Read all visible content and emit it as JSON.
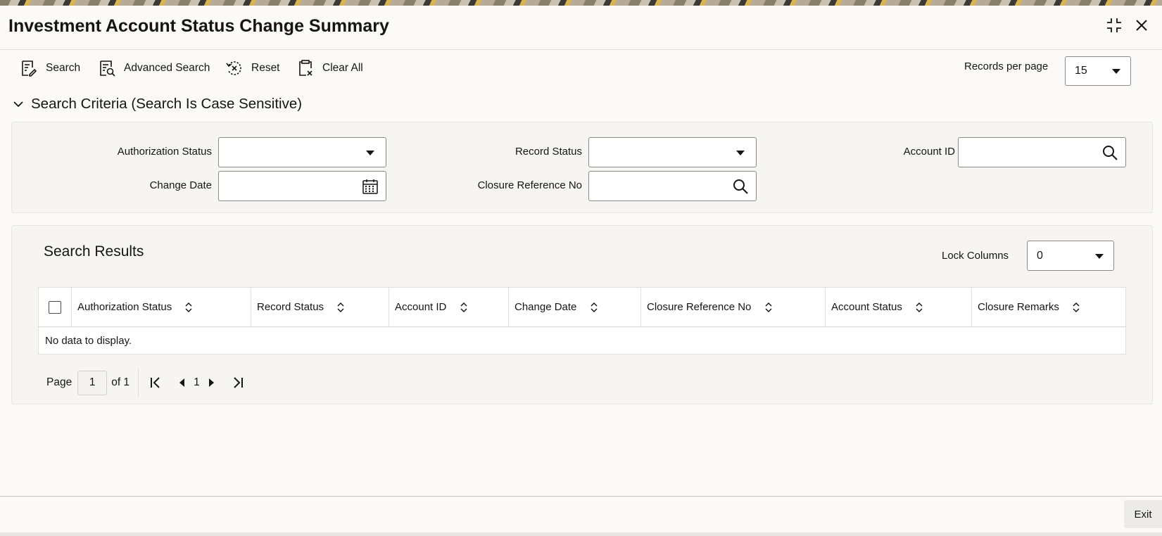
{
  "window": {
    "title": "Investment Account Status Change Summary"
  },
  "toolbar": {
    "search_label": "Search",
    "advanced_search_label": "Advanced Search",
    "reset_label": "Reset",
    "clear_all_label": "Clear All",
    "records_per_page_label": "Records per page",
    "records_per_page_value": "15"
  },
  "criteria": {
    "heading": "Search Criteria (Search Is Case Sensitive)",
    "authorization_status_label": "Authorization Status",
    "authorization_status_value": "",
    "record_status_label": "Record Status",
    "record_status_value": "",
    "account_id_label": "Account ID",
    "account_id_value": "",
    "change_date_label": "Change Date",
    "change_date_value": "",
    "closure_reference_no_label": "Closure Reference No",
    "closure_reference_no_value": ""
  },
  "results": {
    "heading": "Search Results",
    "lock_columns_label": "Lock Columns",
    "lock_columns_value": "0",
    "columns": [
      "Authorization Status",
      "Record Status",
      "Account ID",
      "Change Date",
      "Closure Reference No",
      "Account Status",
      "Closure Remarks"
    ],
    "empty_message": "No data to display.",
    "pagination": {
      "page_label": "Page",
      "current_page": "1",
      "of_label": "of 1",
      "page_number": "1"
    }
  },
  "footer": {
    "exit_label": "Exit"
  },
  "colors": {
    "text": "#161513",
    "border": "#8c8984",
    "panel_bg": "#f6f5f2"
  }
}
